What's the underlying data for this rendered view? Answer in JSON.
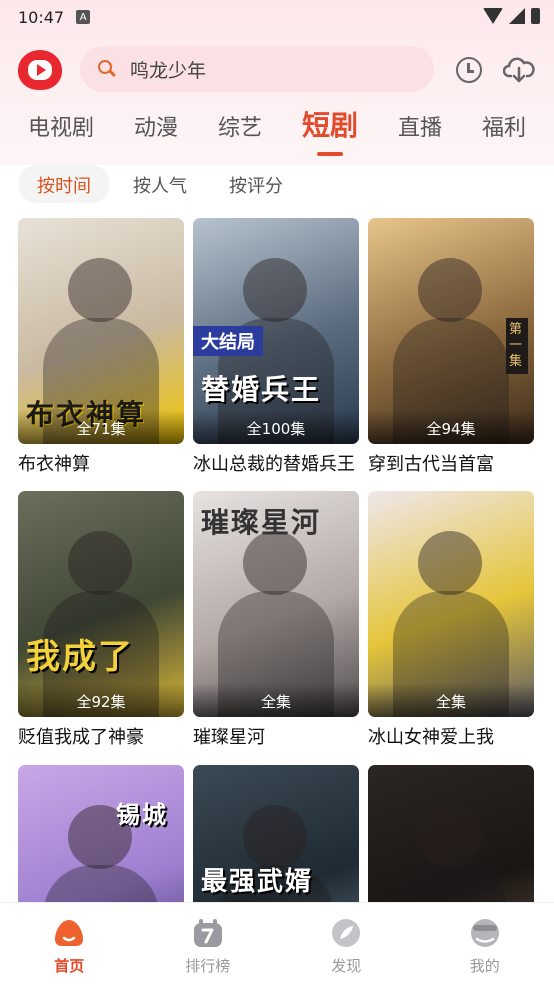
{
  "status_bar": {
    "time": "10:47",
    "a_badge": "A"
  },
  "header": {
    "logo_icon": "app-logo-icon",
    "search": {
      "placeholder": "鸣龙少年",
      "icon": "search-icon"
    },
    "history_icon": "clock-icon",
    "download_icon": "cloud-download-icon"
  },
  "category_tabs": [
    {
      "label": "电视剧",
      "active": false
    },
    {
      "label": "动漫",
      "active": false
    },
    {
      "label": "综艺",
      "active": false
    },
    {
      "label": "短剧",
      "active": true
    },
    {
      "label": "直播",
      "active": false
    },
    {
      "label": "福利",
      "active": false
    }
  ],
  "sort_tabs": [
    {
      "label": "按时间",
      "active": true
    },
    {
      "label": "按人气",
      "active": false
    },
    {
      "label": "按评分",
      "active": false
    }
  ],
  "cards": [
    {
      "title": "布衣神算",
      "episodes": "全71集",
      "poster_text": "布衣神算",
      "colors": [
        "#e8e2d8",
        "#c9b9a0",
        "#f0c400"
      ]
    },
    {
      "title": "冰山总裁的替婚兵王",
      "episodes": "全100集",
      "poster_text": "替婚兵王",
      "badge": "大结局",
      "colors": [
        "#b7c3cf",
        "#5c6d80",
        "#2a3a4e"
      ]
    },
    {
      "title": "穿到古代当首富",
      "episodes": "全94集",
      "badge": "第一集",
      "colors": [
        "#e7c58a",
        "#8c6a3f",
        "#3c2a1a"
      ]
    },
    {
      "title": "贬值我成了神豪",
      "episodes": "全92集",
      "poster_text": "我成了",
      "colors": [
        "#6b6f5c",
        "#3f4735",
        "#d9b637"
      ]
    },
    {
      "title": "璀璨星河",
      "episodes": "全集",
      "poster_text": "璀璨星河",
      "colors": [
        "#e7e3e0",
        "#b3a9a6",
        "#4f4a4c"
      ]
    },
    {
      "title": "冰山女神爱上我",
      "episodes": "全集",
      "colors": [
        "#efe7ec",
        "#e5c53a",
        "#5a5a66"
      ]
    },
    {
      "title": "",
      "episodes": "",
      "poster_text": "锡城",
      "colors": [
        "#c9a7e6",
        "#9d7fd1",
        "#3a2b5f"
      ]
    },
    {
      "title": "",
      "episodes": "",
      "poster_text": "最强武婿",
      "colors": [
        "#3b4a55",
        "#1f2a33",
        "#6a7a86"
      ]
    },
    {
      "title": "",
      "episodes": "",
      "colors": [
        "#2b2623",
        "#1a1614",
        "#6b5444"
      ]
    }
  ],
  "bottom_nav": [
    {
      "label": "首页",
      "icon": "home-icon",
      "active": true,
      "color": "#f0622d"
    },
    {
      "label": "排行榜",
      "icon": "ranking-icon",
      "active": false,
      "color": "#9a9aa0"
    },
    {
      "label": "发现",
      "icon": "discover-icon",
      "active": false,
      "color": "#c4c4c8"
    },
    {
      "label": "我的",
      "icon": "profile-icon",
      "active": false,
      "color": "#b5b5ba"
    }
  ]
}
